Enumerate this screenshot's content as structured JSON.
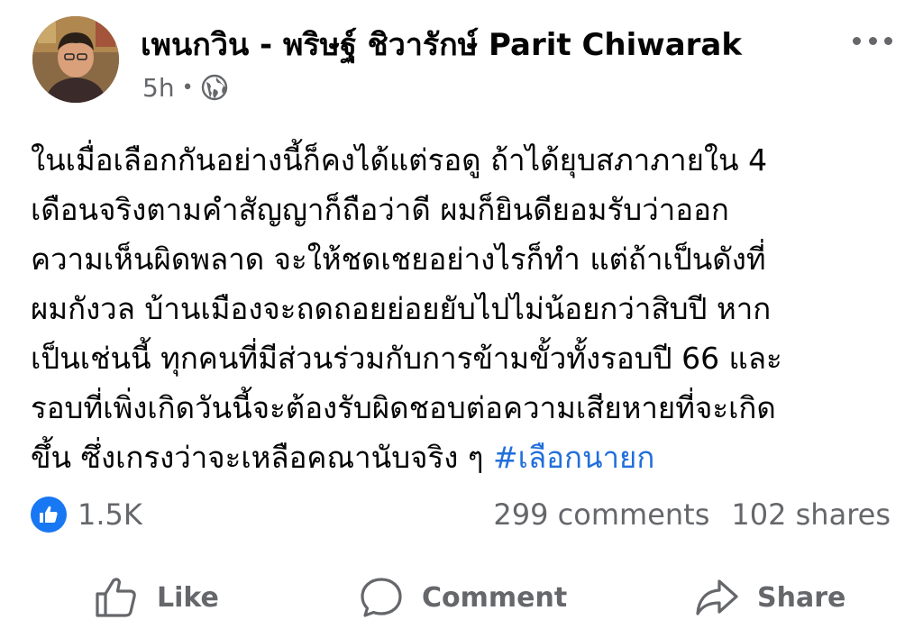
{
  "post": {
    "author_name": "เพนกวิน - พริษฐ์ ชิวารักษ์ Parit Chiwarak",
    "time": "5h",
    "audience_icon": "globe-icon",
    "more_icon": "more-dots-icon",
    "text_lines": [
      "ในเมื่อเลือกกันอย่างนี้ก็คงได้แต่รอดู ถ้าได้ยุบสภาภายใน 4",
      "เดือนจริงตามคำสัญญาก็ถือว่าดี ผมก็ยินดียอมรับว่าออก",
      "ความเห็นผิดพลาด จะให้ชดเชยอย่างไรก็ทำ แต่ถ้าเป็นดังที่",
      "ผมกังวล บ้านเมืองจะถดถอยย่อยยับไปไม่น้อยกว่าสิบปี หาก",
      "เป็นเช่นนี้ ทุกคนที่มีส่วนร่วมกับการข้ามขั้วทั้งรอบปี 66 และ",
      "รอบที่เพิ่งเกิดวันนี้จะต้องรับผิดชอบต่อความเสียหายที่จะเกิด",
      "ขึ้น ซึ่งเกรงว่าจะเหลือคณานับจริง ๆ "
    ],
    "hashtag": "#เลือกนายก",
    "hashtag_color": "#216fdb"
  },
  "engagement": {
    "likes": "1.5K",
    "comments": "299 comments",
    "shares": "102 shares",
    "like_badge_color": "#1877f2"
  },
  "actions": {
    "like": "Like",
    "comment": "Comment",
    "share": "Share"
  }
}
